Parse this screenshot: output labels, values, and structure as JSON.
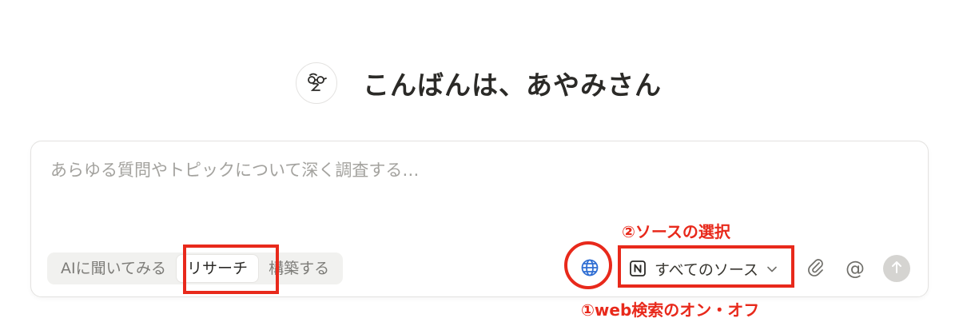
{
  "greeting": {
    "avatar_icon": "glasses-face-icon",
    "text": "こんばんは、あやみさん"
  },
  "composer": {
    "placeholder": "あらゆる質問やトピックについて深く調査する…",
    "value": "",
    "modes": [
      {
        "label": "AIに聞いてみる",
        "active": false
      },
      {
        "label": "リサーチ",
        "active": true
      },
      {
        "label": "構築する",
        "active": false
      }
    ],
    "web_toggle_icon": "globe-icon",
    "web_toggle_on": true,
    "source_select": {
      "icon": "notion-icon",
      "label": "すべてのソース",
      "chevron_icon": "chevron-down-icon"
    },
    "attach_icon": "paperclip-icon",
    "mention_label": "@",
    "send_icon": "arrow-up-icon"
  },
  "annotations": {
    "source_label": "②ソースの選択",
    "web_label": "①web検索のオン・オフ",
    "color": "#e8291b"
  },
  "colors": {
    "accent_globe": "#2f6ed3",
    "annotation_red": "#e8291b",
    "send_disabled": "#d5d4d1"
  }
}
